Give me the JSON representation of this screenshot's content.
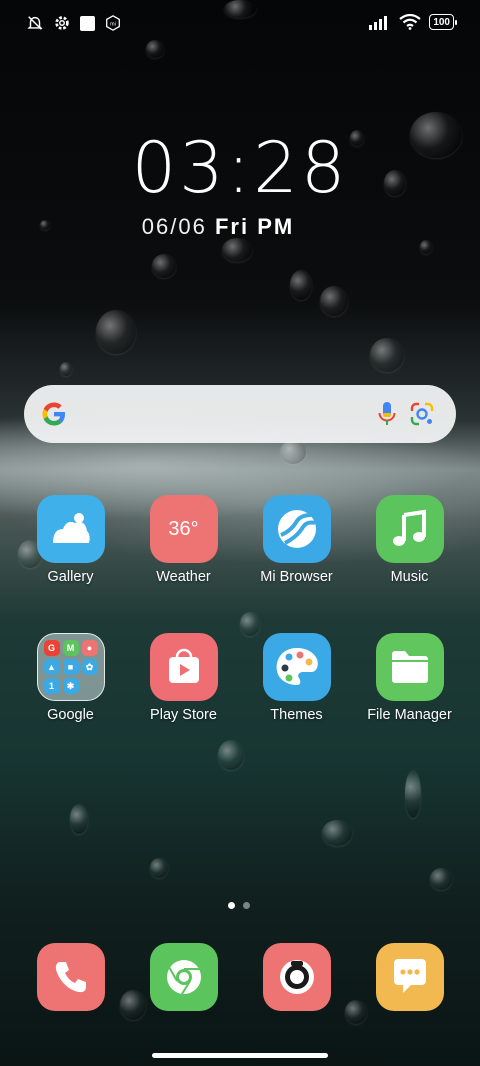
{
  "status_bar": {
    "left_icons": [
      "mute-vibrate-icon",
      "settings-gear-icon",
      "square-notification-icon",
      "mi-icon"
    ],
    "right_icons": [
      "signal-icon",
      "wifi-icon",
      "battery-icon"
    ],
    "battery_level": "100"
  },
  "clock": {
    "time": "03:28",
    "date": "06/06",
    "weekday": "Fri",
    "meridiem": "PM"
  },
  "search": {
    "left_icon": "google-g-icon",
    "voice_icon": "mic-icon",
    "lens_icon": "google-lens-icon"
  },
  "apps": [
    {
      "label": "Gallery",
      "color": "#3fb0ea"
    },
    {
      "label": "Weather",
      "color": "#ee7373",
      "temp": "36°"
    },
    {
      "label": "Mi Browser",
      "color": "#3aa9e6"
    },
    {
      "label": "Music",
      "color": "#5cc45c"
    },
    {
      "label": "Google"
    },
    {
      "label": "Play Store",
      "color": "#ee6e74"
    },
    {
      "label": "Themes",
      "color": "#3aa9e6"
    },
    {
      "label": "File Manager",
      "color": "#62c65e"
    }
  ],
  "google_folder_apps": [
    "G",
    "M",
    "maps",
    "drive",
    "meet",
    "photos",
    "1",
    "settings",
    ""
  ],
  "pager": {
    "pages": 2,
    "active": 0
  },
  "dock": [
    {
      "name": "phone",
      "color": "#ee7373"
    },
    {
      "name": "chrome",
      "color": "#5cc45c"
    },
    {
      "name": "camera",
      "color": "#ee7373"
    },
    {
      "name": "messages",
      "color": "#f1b94f"
    }
  ]
}
